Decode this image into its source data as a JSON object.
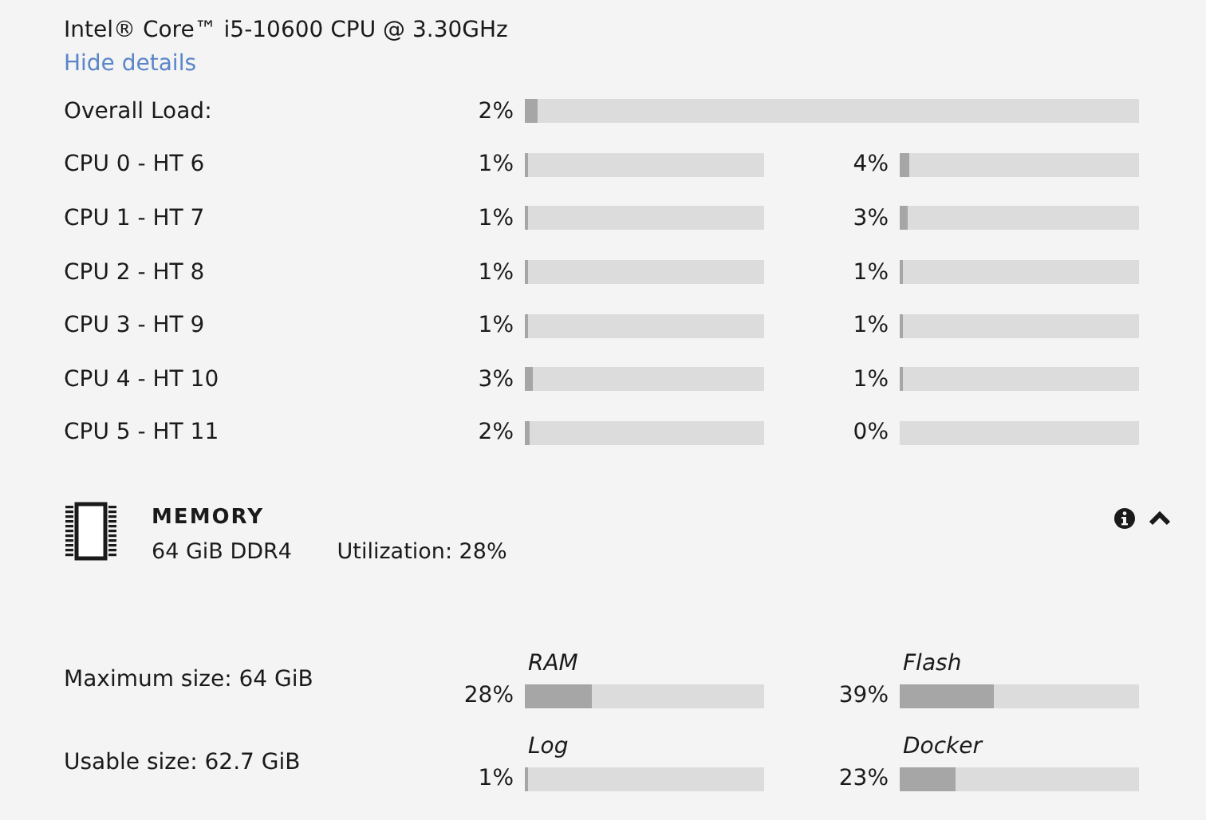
{
  "cpu": {
    "model": "Intel® Core™ i5-10600 CPU @ 3.30GHz",
    "details_link": "Hide details",
    "overall": {
      "label": "Overall Load:",
      "reading": "2%",
      "level": 0.02
    },
    "cores": [
      {
        "label": "CPU 0 - HT 6",
        "a": {
          "reading": "1%",
          "level": 0.01
        },
        "b": {
          "reading": "4%",
          "level": 0.04
        }
      },
      {
        "label": "CPU 1 - HT 7",
        "a": {
          "reading": "1%",
          "level": 0.01
        },
        "b": {
          "reading": "3%",
          "level": 0.03
        }
      },
      {
        "label": "CPU 2 - HT 8",
        "a": {
          "reading": "1%",
          "level": 0.01
        },
        "b": {
          "reading": "1%",
          "level": 0.01
        }
      },
      {
        "label": "CPU 3 - HT 9",
        "a": {
          "reading": "1%",
          "level": 0.01
        },
        "b": {
          "reading": "1%",
          "level": 0.01
        }
      },
      {
        "label": "CPU 4 - HT 10",
        "a": {
          "reading": "3%",
          "level": 0.03
        },
        "b": {
          "reading": "1%",
          "level": 0.01
        }
      },
      {
        "label": "CPU 5 - HT 11",
        "a": {
          "reading": "2%",
          "level": 0.02
        },
        "b": {
          "reading": "0%",
          "level": 0.0
        }
      }
    ]
  },
  "memory": {
    "title": "MEMORY",
    "spec": "64 GiB DDR4",
    "utilization": "Utilization: 28%",
    "rows": [
      {
        "label": "Maximum size: 64 GiB",
        "a": {
          "name": "RAM",
          "reading": "28%",
          "level": 0.28
        },
        "b": {
          "name": "Flash",
          "reading": "39%",
          "level": 0.39
        }
      },
      {
        "label": "Usable size: 62.7 GiB",
        "a": {
          "name": "Log",
          "reading": "1%",
          "level": 0.01
        },
        "b": {
          "name": "Docker",
          "reading": "23%",
          "level": 0.23
        }
      }
    ]
  }
}
